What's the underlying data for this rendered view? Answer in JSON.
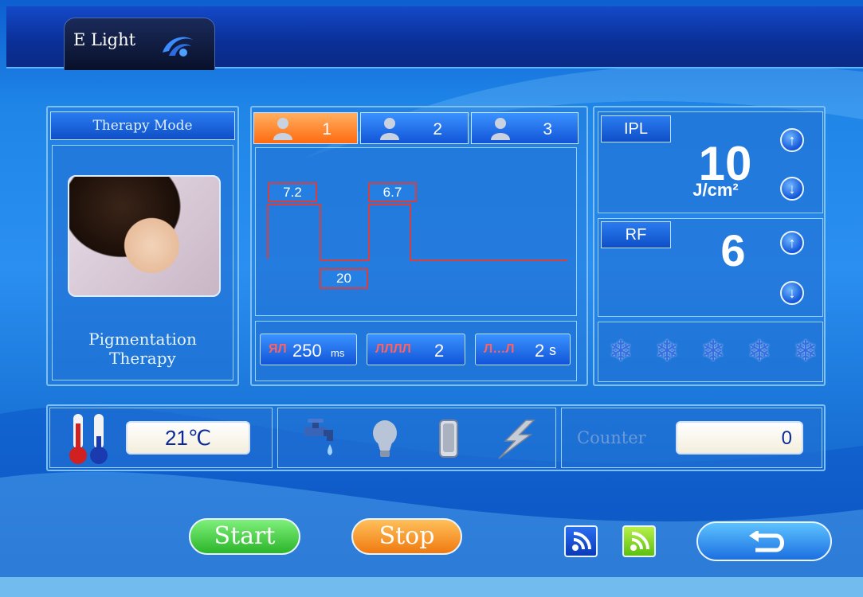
{
  "window": {
    "title": "E Light"
  },
  "therapy": {
    "header": "Therapy Mode",
    "name_line1": "Pigmentation",
    "name_line2": "Therapy"
  },
  "users": [
    {
      "label": "1",
      "active": true
    },
    {
      "label": "2",
      "active": false
    },
    {
      "label": "3",
      "active": false
    }
  ],
  "pulse": {
    "pulse1": "7.2",
    "delay": "20",
    "pulse2": "6.7"
  },
  "params": {
    "width": "250",
    "width_unit": "ms",
    "count": "2",
    "interval": "2",
    "interval_unit": "s"
  },
  "ipl": {
    "label": "IPL",
    "value": "10",
    "unit": "J/cm²"
  },
  "rf": {
    "label": "RF",
    "value": "6"
  },
  "cooling": {
    "level": 5,
    "max": 5
  },
  "temperature": {
    "value": "21℃"
  },
  "status_icons": [
    "water-tap-icon",
    "lamp-icon",
    "tank-icon",
    "lightning-icon"
  ],
  "counter": {
    "label": "Counter",
    "value": "0"
  },
  "controls": {
    "start": "Start",
    "stop": "Stop"
  },
  "colors": {
    "accent": "#1a74d8",
    "start": "#3cc53a",
    "stop": "#f59a2a",
    "active_tab": "#ff8a30",
    "pulse": "#d84040"
  }
}
